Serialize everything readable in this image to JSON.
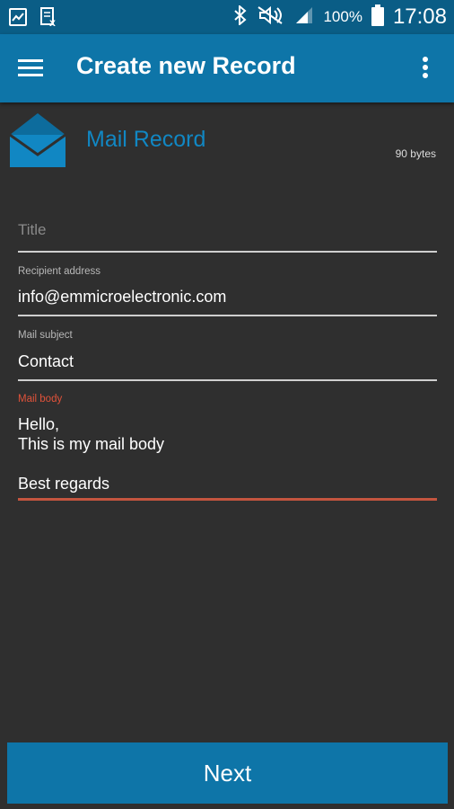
{
  "status_bar": {
    "battery_percent": "100%",
    "time": "17:08",
    "icons": [
      "gallery-icon",
      "data-icon",
      "bluetooth-icon",
      "mute-icon",
      "signal-icon",
      "battery-icon"
    ]
  },
  "app_bar": {
    "title": "Create new Record",
    "menu_icon": "hamburger-menu-icon",
    "overflow_icon": "more-vertical-icon"
  },
  "record": {
    "icon": "mail-icon",
    "type_label": "Mail Record",
    "size": "90 bytes"
  },
  "form": {
    "title_field": {
      "placeholder": "Title",
      "value": ""
    },
    "recipient": {
      "label": "Recipient address",
      "value": "info@emmicroelectronic.com"
    },
    "subject": {
      "label": "Mail subject",
      "value": "Contact"
    },
    "body": {
      "label": "Mail body",
      "value": "Hello,\nThis is my mail body\n\nBest regards"
    }
  },
  "footer": {
    "next_label": "Next"
  },
  "colors": {
    "status_bar": "#0a5d86",
    "app_bar": "#0e75a8",
    "background": "#2f2f2f",
    "accent_blue": "#1187c3",
    "error_active": "#e0523a"
  }
}
